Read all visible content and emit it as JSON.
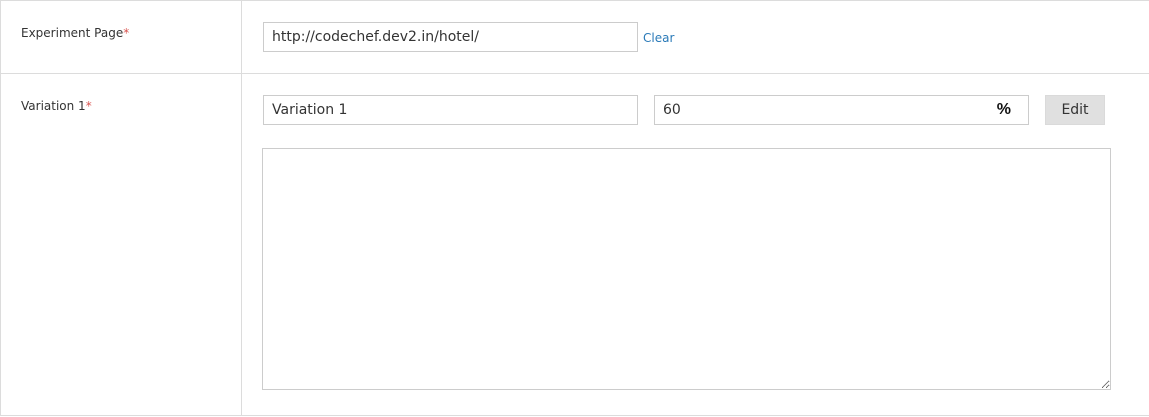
{
  "experiment_page": {
    "label": "Experiment Page",
    "required_mark": "*",
    "url_value": "http://codechef.dev2.in/hotel/",
    "clear_label": "Clear"
  },
  "variation": {
    "label": "Variation 1",
    "required_mark": "*",
    "name_value": "Variation 1",
    "percent_value": "60",
    "percent_symbol": "%",
    "edit_label": "Edit",
    "code_value": ""
  },
  "colors": {
    "required": "#d9534f",
    "link": "#2a7ab8",
    "border": "#dcdcdc",
    "button_bg": "#e0e0e0"
  }
}
